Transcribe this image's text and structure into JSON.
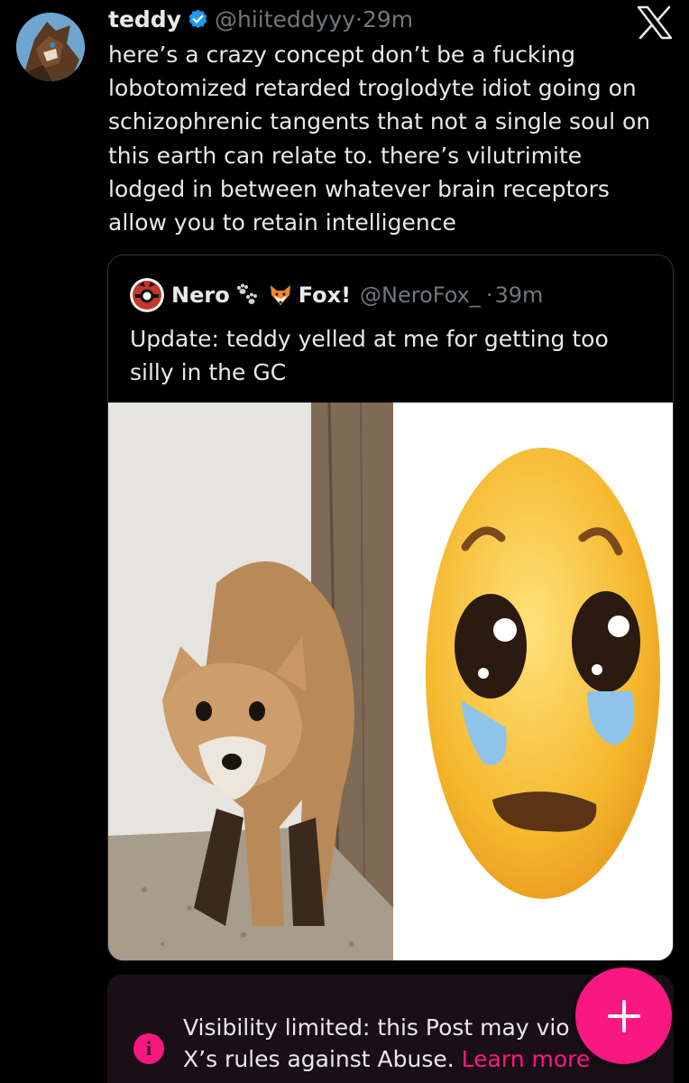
{
  "tweet": {
    "name": "teddy",
    "handle": "@hiiteddyyy",
    "separator": "·",
    "time": "29m",
    "text": "here’s a crazy concept don’t be a fucking\nlobotomized retarded troglodyte idiot going on\nschizophrenic tangents that not a single soul on\nthis earth can relate to. there’s vilutrimite\nlodged in between whatever brain receptors\nallow you to retain intelligence"
  },
  "quote": {
    "name_part1": "Nero",
    "name_part2": "Fox!",
    "handle": "@NeroFox_",
    "separator": "·",
    "time": "39m",
    "text": "Update: teddy yelled at me for getting too\nsilly in the GC"
  },
  "notice": {
    "text": "Visibility limited: this Post may vio",
    "text2": "X’s rules against Abuse.",
    "link": "Learn more",
    "icon": "i"
  },
  "icons": {
    "verified": "verified-badge-icon",
    "x_logo": "x-logo-icon",
    "info": "info-icon",
    "compose": "plus-icon"
  },
  "colors": {
    "background": "#000000",
    "text": "#e7e9ea",
    "muted": "#71767b",
    "accent": "#f91880",
    "verified": "#1d9bf0"
  }
}
